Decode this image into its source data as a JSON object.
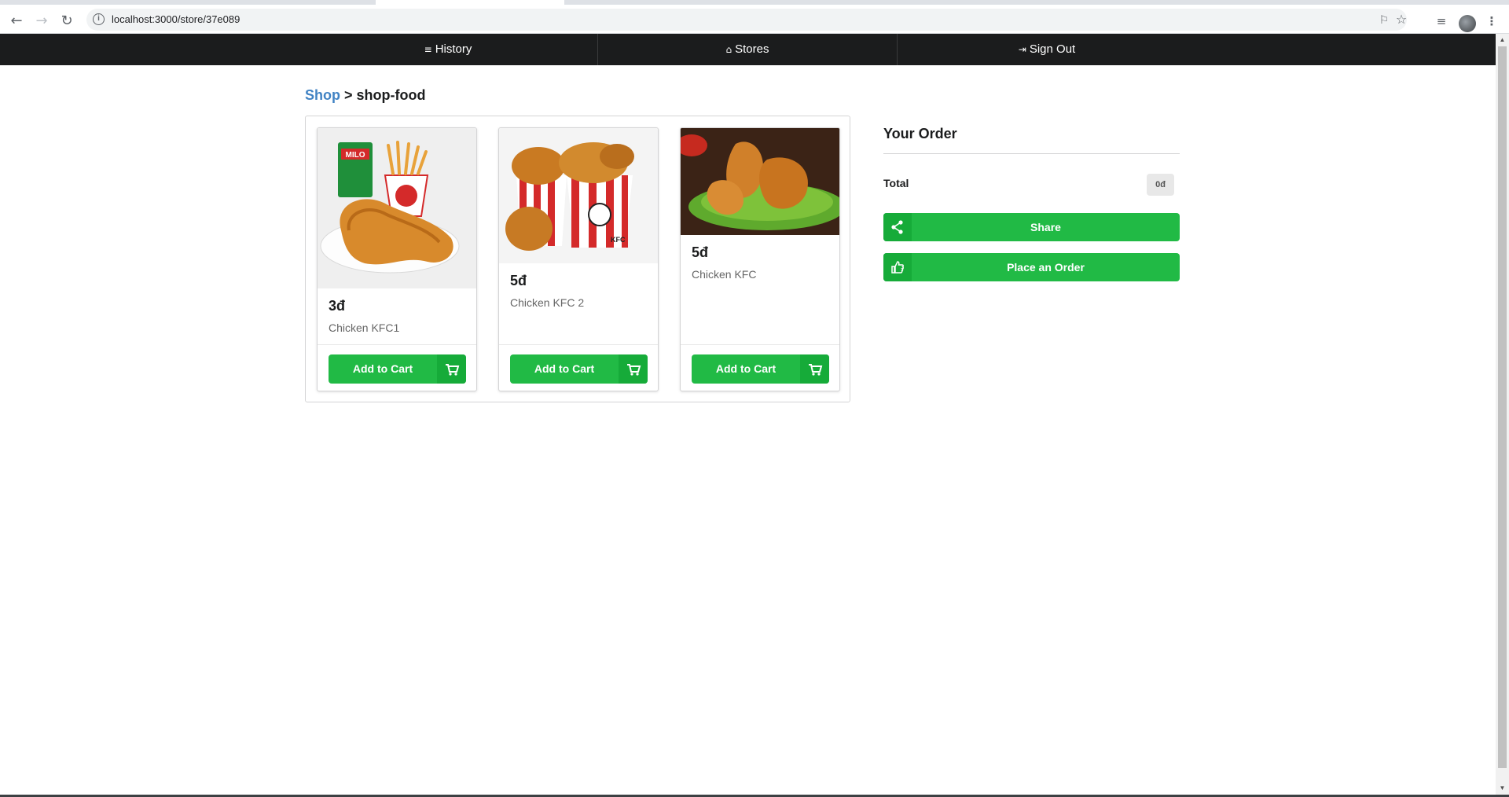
{
  "browser": {
    "url": "localhost:3000/store/37e089"
  },
  "nav": {
    "items": [
      {
        "label": "History",
        "icon": "list-icon"
      },
      {
        "label": "Stores",
        "icon": "home-icon"
      },
      {
        "label": "Sign Out",
        "icon": "sign-out-icon"
      }
    ]
  },
  "breadcrumb": {
    "link": "Shop",
    "separator": ">",
    "current": "shop-food"
  },
  "products": [
    {
      "price": "3đ",
      "name": "Chicken KFC1",
      "button": "Add to Cart"
    },
    {
      "price": "5đ",
      "name": "Chicken KFC 2",
      "button": "Add to Cart"
    },
    {
      "price": "5đ",
      "name": "Chicken KFC",
      "button": "Add to Cart"
    }
  ],
  "order": {
    "title": "Your Order",
    "total_label": "Total",
    "total_value": "0đ",
    "share_label": "Share",
    "place_label": "Place an Order"
  },
  "colors": {
    "primary_green": "#21ba45",
    "dark_green": "#16ab39",
    "navbar": "#1b1c1d",
    "link_blue": "#4183c4"
  }
}
